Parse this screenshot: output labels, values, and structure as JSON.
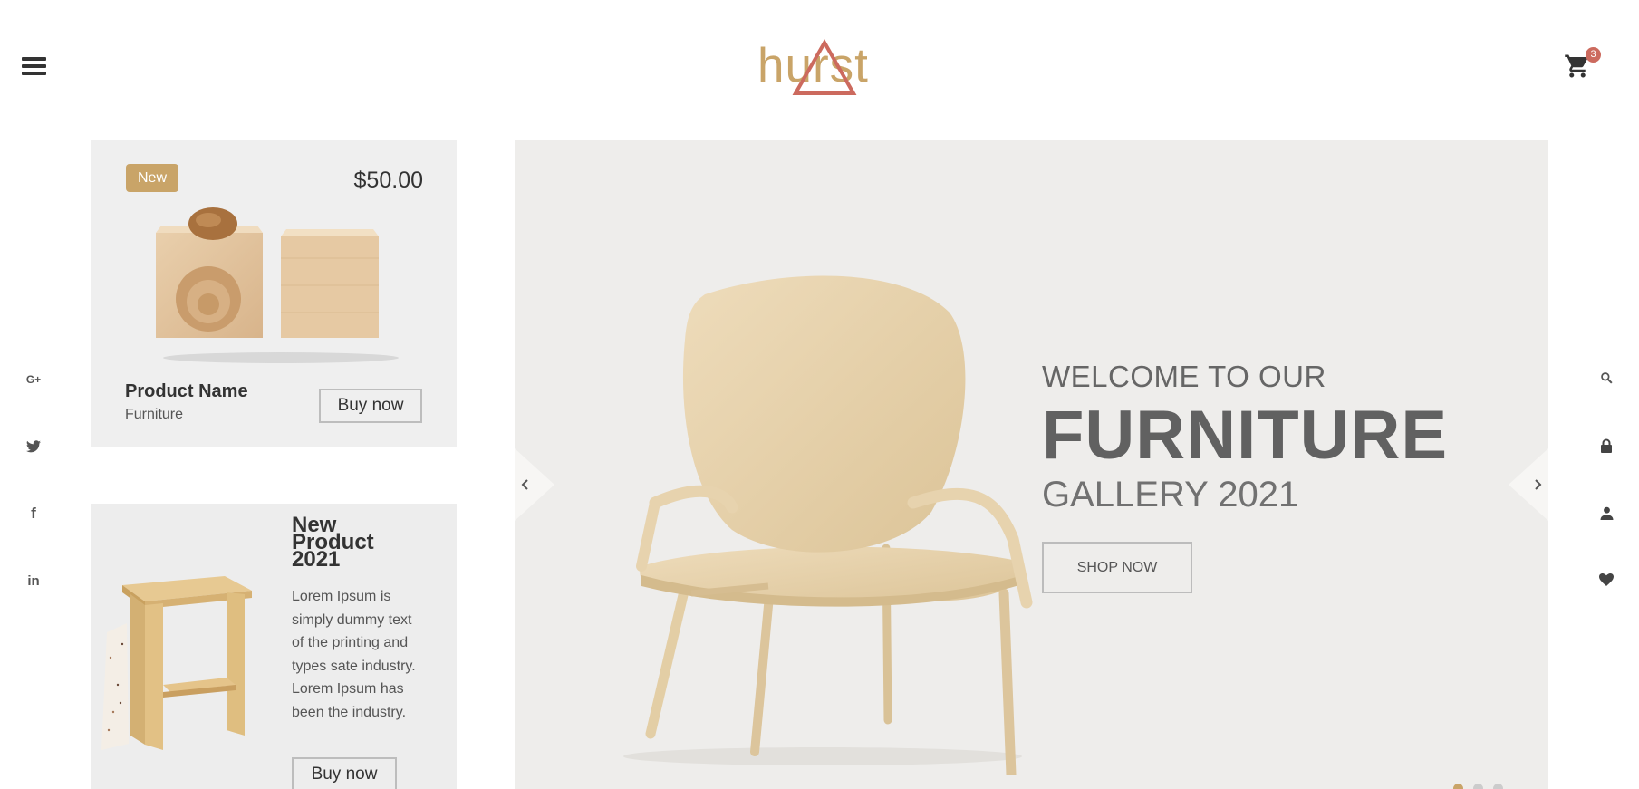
{
  "header": {
    "logo_text": "hurst",
    "cart_count": "3"
  },
  "social": {
    "items": [
      {
        "name": "google-plus",
        "glyph": "G+"
      },
      {
        "name": "twitter",
        "glyph": "🐦"
      },
      {
        "name": "facebook",
        "glyph": "f"
      },
      {
        "name": "linkedin",
        "glyph": "in"
      }
    ]
  },
  "tools": {
    "items": [
      "search-icon",
      "lock-icon",
      "user-icon",
      "heart-icon"
    ]
  },
  "product_card": {
    "badge": "New",
    "price": "$50.00",
    "name": "Product Name",
    "category": "Furniture",
    "buy_label": "Buy now"
  },
  "promo_card": {
    "title": "New Product 2021",
    "description": "Lorem Ipsum is simply dummy text of the printing and types sate industry. Lorem Ipsum has been the industry.",
    "buy_label": "Buy now"
  },
  "hero": {
    "subtitle": "WELCOME TO OUR",
    "title": "FURNITURE",
    "gallery": "GALLERY 2021",
    "cta": "SHOP NOW",
    "slides_total": 3,
    "active_slide": 1
  },
  "colors": {
    "accent": "#c9a468",
    "badge_red": "#cc6a5e",
    "text_dark": "#333333"
  }
}
